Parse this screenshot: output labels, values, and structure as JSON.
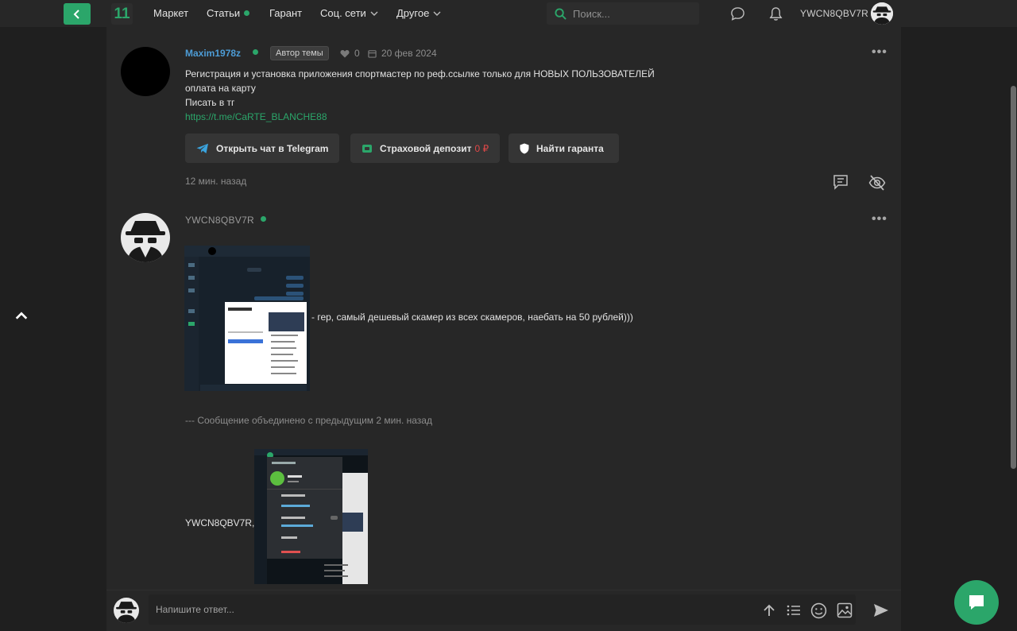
{
  "nav": {
    "logo_text": "11",
    "items": [
      {
        "label": "Маркет"
      },
      {
        "label": "Статьи"
      },
      {
        "label": "Гарант"
      },
      {
        "label": "Соц. сети"
      },
      {
        "label": "Другое"
      }
    ],
    "search_placeholder": "Поиск...",
    "username": "YWCN8QBV7R"
  },
  "post1": {
    "author": "Maxim1978z",
    "badge": "Автор темы",
    "likes": "0",
    "date": "20 фев 2024",
    "lines": [
      "Регистрация и установка приложения спортмастер по реф.ссылке только для НОВЫХ ПОЛЬЗОВАТЕЛЕЙ",
      "оплата на карту",
      "Писать в тг"
    ],
    "link": "https://t.me/CaRTE_BLANCHE88",
    "buttons": {
      "telegram": "Открыть чат в Telegram",
      "deposit": "Страховой депозит",
      "deposit_value": "0 ₽",
      "guarantor": "Найти гаранта"
    },
    "time": "12 мин. назад"
  },
  "post2": {
    "author": "YWCN8QBV7R",
    "text1": "- гер, самый дешевый скамер из всех скамеров, наебать на 50 рублей)))",
    "merged_note": "--- Сообщение объединено с предыдущим 2 мин. назад",
    "text2": "YWCN8QBV7R,"
  },
  "reply": {
    "placeholder": "Напишите ответ..."
  },
  "colors": {
    "accent": "#2ba66a",
    "link": "#4d9cd6",
    "warn": "#e04848"
  }
}
